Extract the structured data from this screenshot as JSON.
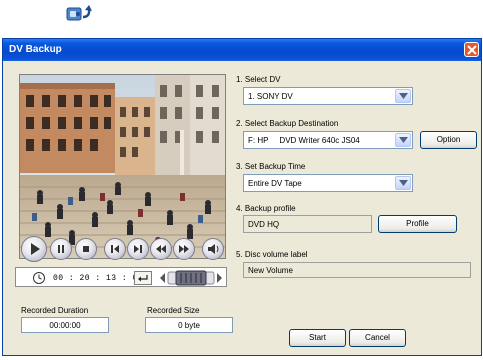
{
  "dialog": {
    "title": "DV Backup"
  },
  "timecode": "00 : 20 : 13 : 05",
  "recorded_duration": {
    "label": "Recorded Duration",
    "value": "00:00:00"
  },
  "recorded_size": {
    "label": "Recorded Size",
    "value": "0 byte"
  },
  "steps": {
    "select_dv": {
      "label": "1. Select DV",
      "value": "1. SONY DV"
    },
    "backup_destination": {
      "label": "2. Select Backup Destination",
      "value": "F: HP     DVD Writer 640c JS04",
      "option_button": "Option"
    },
    "backup_time": {
      "label": "3. Set Backup Time",
      "value": "Entire DV Tape"
    },
    "backup_profile": {
      "label": "4. Backup profile",
      "value": "DVD HQ",
      "profile_button": "Profile"
    },
    "volume_label": {
      "label": "5. Disc volume label",
      "value": "New Volume"
    }
  },
  "buttons": {
    "start": "Start",
    "cancel": "Cancel"
  },
  "colors": {
    "titlebar": "#0649cd",
    "dialog_bg": "#ece9d8",
    "close": "#e05a2d"
  }
}
